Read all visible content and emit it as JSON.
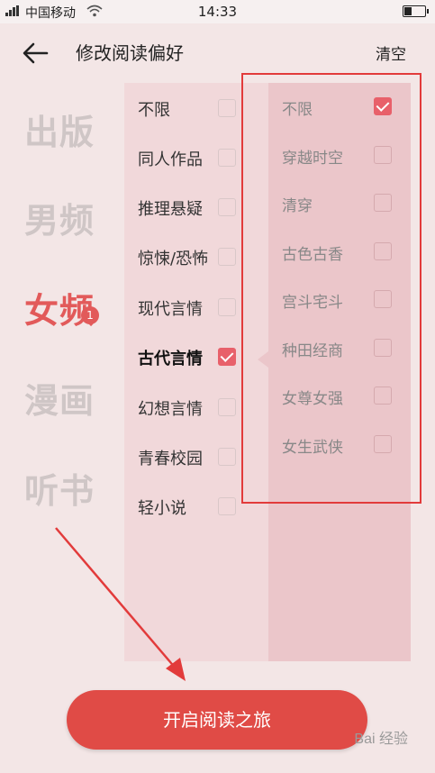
{
  "status_bar": {
    "carrier": "中国移动",
    "time": "14:33"
  },
  "header": {
    "title": "修改阅读偏好",
    "clear_label": "清空"
  },
  "categories": [
    {
      "label": "出版",
      "active": false
    },
    {
      "label": "男频",
      "active": false
    },
    {
      "label": "女频",
      "active": true,
      "badge": "1"
    },
    {
      "label": "漫画",
      "active": false
    },
    {
      "label": "听书",
      "active": false
    }
  ],
  "subcategories": [
    {
      "label": "不限",
      "checked": false
    },
    {
      "label": "同人作品",
      "checked": false
    },
    {
      "label": "推理悬疑",
      "checked": false
    },
    {
      "label": "惊悚/恐怖",
      "checked": false
    },
    {
      "label": "现代言情",
      "checked": false
    },
    {
      "label": "古代言情",
      "checked": true
    },
    {
      "label": "幻想言情",
      "checked": false
    },
    {
      "label": "青春校园",
      "checked": false
    },
    {
      "label": "轻小说",
      "checked": false
    }
  ],
  "tags": [
    {
      "label": "不限",
      "checked": true
    },
    {
      "label": "穿越时空",
      "checked": false
    },
    {
      "label": "清穿",
      "checked": false
    },
    {
      "label": "古色古香",
      "checked": false
    },
    {
      "label": "宫斗宅斗",
      "checked": false
    },
    {
      "label": "种田经商",
      "checked": false
    },
    {
      "label": "女尊女强",
      "checked": false
    },
    {
      "label": "女生武侠",
      "checked": false
    }
  ],
  "start_button_label": "开启阅读之旅",
  "watermark": "Bai 经验",
  "colors": {
    "accent": "#e04b46",
    "highlight_box": "#e23b3b",
    "category_inactive": "#cfc6c6"
  }
}
